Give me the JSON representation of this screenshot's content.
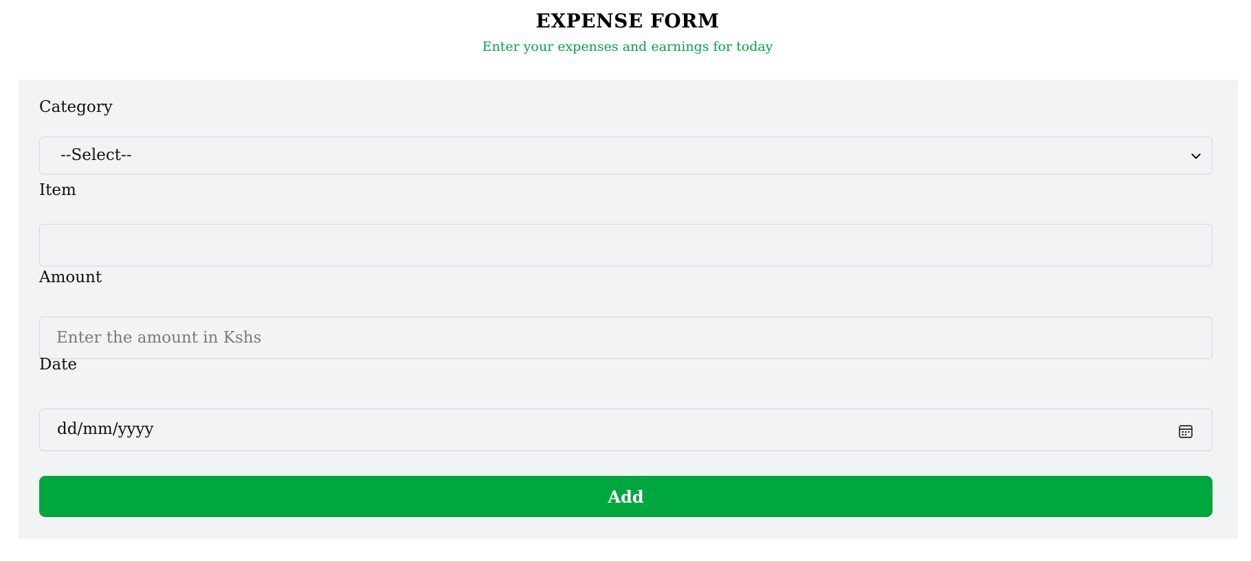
{
  "header": {
    "title": "EXPENSE FORM",
    "subtitle": "Enter your expenses and earnings for today"
  },
  "form": {
    "category": {
      "label": "Category",
      "selected": "--Select--",
      "icon": "chevron-down-icon"
    },
    "item": {
      "label": "Item",
      "value": "",
      "placeholder": ""
    },
    "amount": {
      "label": "Amount",
      "value": "",
      "placeholder": "Enter the amount in Kshs"
    },
    "date": {
      "label": "Date",
      "value": "dd/mm/yyyy",
      "icon": "calendar-icon"
    },
    "submit_label": "Add"
  },
  "colors": {
    "accent": "#00a63e",
    "panel_background": "#f2f3f5",
    "field_border": "#d4d6da"
  }
}
